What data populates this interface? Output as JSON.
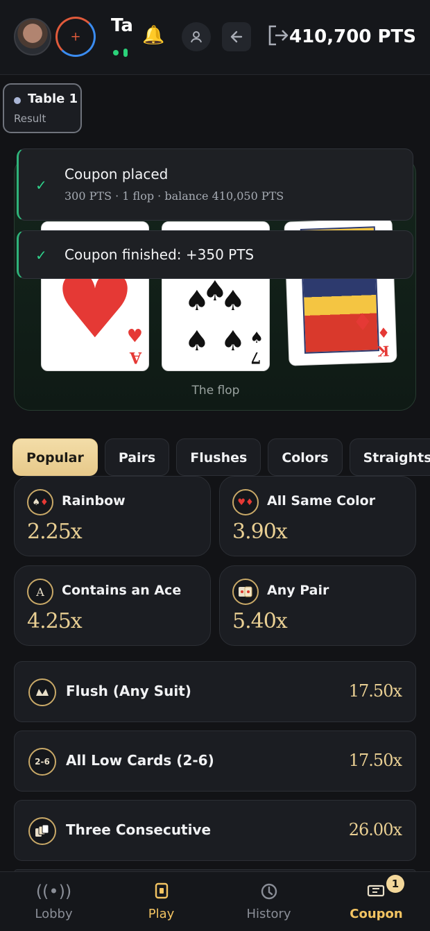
{
  "header": {
    "name_truncated": "Ta",
    "points": "410,700 PTS"
  },
  "table_chip": {
    "title": "Table 1",
    "subtitle": "Result"
  },
  "board": {
    "caption": "The flop",
    "cards": [
      {
        "rank": "A",
        "suit": "hearts",
        "symbol": "♥",
        "color": "#e53935"
      },
      {
        "rank": "7",
        "suit": "spades",
        "symbol": "♠",
        "color": "#111111"
      },
      {
        "rank": "K",
        "suit": "diamonds",
        "symbol": "♦",
        "color": "#e53935"
      }
    ]
  },
  "toasts": [
    {
      "title": "Coupon placed",
      "subtitle": "300 PTS · 1 flop · balance 410,050 PTS"
    },
    {
      "title": "Coupon finished: +350 PTS"
    }
  ],
  "tabs": [
    "Popular",
    "Pairs",
    "Flushes",
    "Colors",
    "Straights"
  ],
  "tiles": [
    {
      "label": "Rainbow",
      "odds": "2.25x",
      "icon": "rainbow-suits-icon"
    },
    {
      "label": "All Same Color",
      "odds": "3.90x",
      "icon": "same-color-icon"
    },
    {
      "label": "Contains an Ace",
      "odds": "4.25x",
      "icon": "ace-icon"
    },
    {
      "label": "Any Pair",
      "odds": "5.40x",
      "icon": "pair-icon"
    }
  ],
  "rows": [
    {
      "label": "Flush (Any Suit)",
      "odds": "17.50x",
      "icon": "flush-icon",
      "icon_text": ""
    },
    {
      "label": "All Low Cards (2-6)",
      "odds": "17.50x",
      "icon": "low-cards-icon",
      "icon_text": "2-6"
    },
    {
      "label": "Three Consecutive",
      "odds": "26.00x",
      "icon": "consecutive-cards-icon",
      "icon_text": ""
    }
  ],
  "nav": [
    {
      "label": "Lobby",
      "icon": "broadcast-icon"
    },
    {
      "label": "Play",
      "icon": "play-cards-icon"
    },
    {
      "label": "History",
      "icon": "history-icon"
    },
    {
      "label": "Coupon",
      "icon": "coupon-icon",
      "badge": "1"
    }
  ],
  "colors": {
    "accent_gold": "#e9cf93",
    "success_green": "#2fd08a"
  }
}
